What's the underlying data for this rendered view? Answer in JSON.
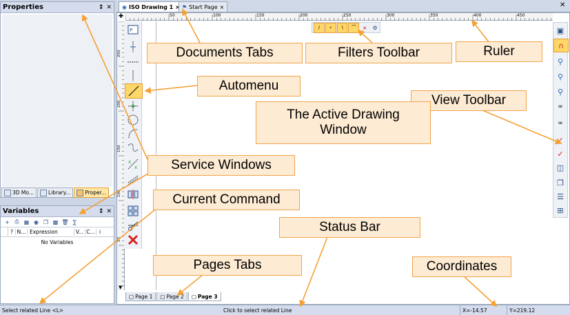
{
  "properties_panel": {
    "title": "Properties",
    "pin": "↕",
    "close": "✕"
  },
  "service_tabs": [
    {
      "label": "3D Mo...",
      "icon": "3d-model-icon"
    },
    {
      "label": "Library...",
      "icon": "library-icon"
    },
    {
      "label": "Proper...",
      "icon": "properties-icon"
    }
  ],
  "variables_panel": {
    "title": "Variables",
    "pin": "↕",
    "close": "✕",
    "columns": [
      "?",
      "N...",
      "Expression",
      "V...",
      "C..."
    ],
    "empty_text": "No Variables"
  },
  "document_tabs": [
    {
      "label": "ISO Drawing 1",
      "close": "×",
      "active": true
    },
    {
      "label": "Start Page",
      "close": "×",
      "active": false
    }
  ],
  "ruler": {
    "ticks": [
      "50",
      "100",
      "150",
      "200",
      "250",
      "300",
      "350",
      "400",
      "450"
    ],
    "vticks": [
      "250",
      "200",
      "150",
      "100",
      "50"
    ]
  },
  "page_tabs": [
    {
      "label": "Page 1",
      "active": false
    },
    {
      "label": "Page 2",
      "active": false
    },
    {
      "label": "Page 3",
      "active": true
    }
  ],
  "status_bar": {
    "current_command": "Select related Line <L>",
    "message": "Click to select related Line",
    "x": "X=-14.57",
    "y": "Y=219.12"
  },
  "callouts": {
    "documents_tabs": "Documents Tabs",
    "filters_toolbar": "Filters Toolbar",
    "ruler": "Ruler",
    "automenu": "Automenu",
    "view_toolbar": "View Toolbar",
    "active_window": "The Active Drawing Window",
    "service_windows": "Service Windows",
    "current_command": "Current Command",
    "status_bar": "Status Bar",
    "pages_tabs": "Pages Tabs",
    "coordinates": "Coordinates"
  },
  "colors": {
    "accent": "#f5a033",
    "callout_bg": "#fdebd3",
    "panel_head": "#d4dced",
    "background": "#ccd5e3"
  }
}
